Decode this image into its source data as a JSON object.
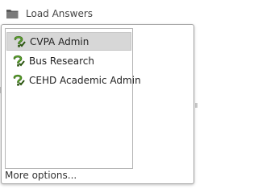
{
  "menu": {
    "load_answers_label": "Load Answers"
  },
  "dropdown": {
    "items": [
      {
        "label": "CVPA Admin",
        "icon": "question-check-icon",
        "selected": true
      },
      {
        "label": "Bus Research",
        "icon": "question-check-icon",
        "selected": false
      },
      {
        "label": "CEHD Academic Admin",
        "icon": "question-check-icon",
        "selected": false
      }
    ],
    "more_options_label": "More options..."
  },
  "colors": {
    "icon_green": "#4a8a1c",
    "icon_dark": "#2b5510",
    "selected_bg": "#d7d7d7"
  }
}
